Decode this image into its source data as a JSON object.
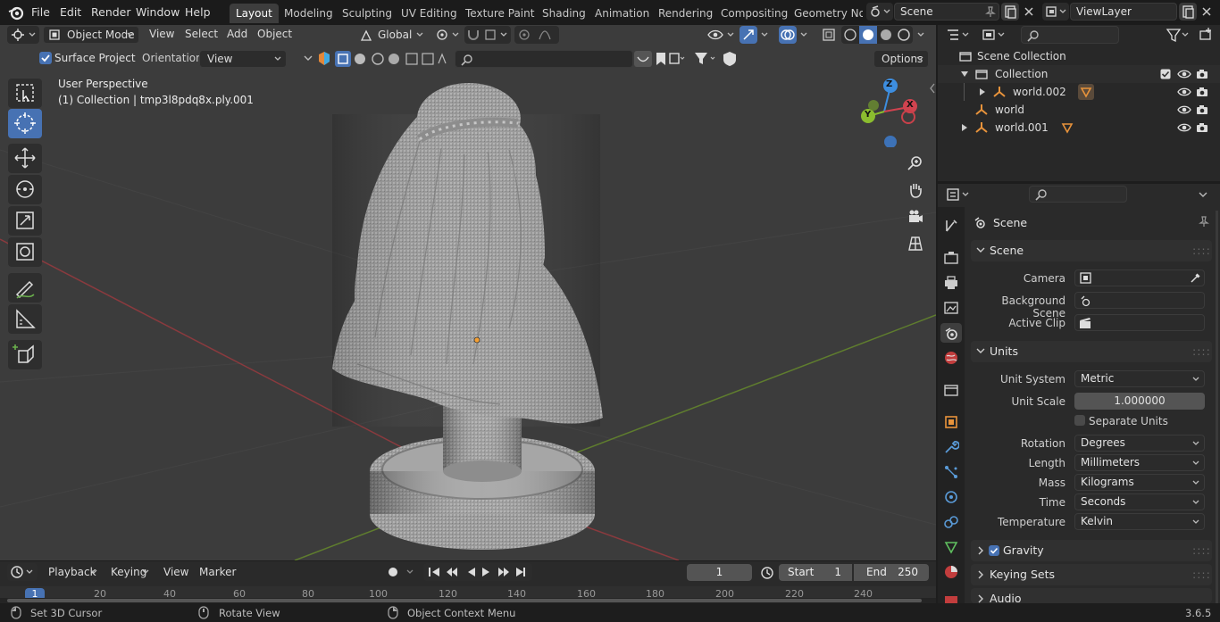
{
  "menus": [
    "File",
    "Edit",
    "Render",
    "Window",
    "Help"
  ],
  "workspaces": [
    "Layout",
    "Modeling",
    "Sculpting",
    "UV Editing",
    "Texture Paint",
    "Shading",
    "Animation",
    "Rendering",
    "Compositing",
    "Geometry Noc"
  ],
  "scene_field": "Scene",
  "viewlayer_field": "ViewLayer",
  "viewport_header": {
    "mode": "Object Mode",
    "menus": [
      "View",
      "Select",
      "Add",
      "Object"
    ],
    "transform_orientation": "Global",
    "surface_project": "Surface Project",
    "orientation_label": "Orientation:",
    "orientation_value": "View",
    "options": "Options"
  },
  "viewport_overlay": {
    "perspective": "User Perspective",
    "collection_info": "(1) Collection | tmp3l8pdq8x.ply.001"
  },
  "gizmo": {
    "x": "X",
    "y": "Y",
    "z": "Z"
  },
  "outliner": {
    "rows": [
      {
        "label": "Scene Collection"
      },
      {
        "label": "Collection"
      },
      {
        "label": "world.002"
      },
      {
        "label": "world"
      },
      {
        "label": "world.001"
      }
    ]
  },
  "properties": {
    "context": "Scene",
    "scene_panel": {
      "title": "Scene",
      "camera_label": "Camera",
      "background_label": "Background Scene",
      "clip_label": "Active Clip"
    },
    "units_panel": {
      "title": "Units",
      "unit_system_label": "Unit System",
      "unit_system": "Metric",
      "unit_scale_label": "Unit Scale",
      "unit_scale": "1.000000",
      "separate_units": "Separate Units",
      "rotation_label": "Rotation",
      "rotation": "Degrees",
      "length_label": "Length",
      "length": "Millimeters",
      "mass_label": "Mass",
      "mass": "Kilograms",
      "time_label": "Time",
      "time": "Seconds",
      "temperature_label": "Temperature",
      "temperature": "Kelvin"
    },
    "gravity": "Gravity",
    "keying_sets": "Keying Sets",
    "audio": "Audio"
  },
  "timeline": {
    "playback": "Playback",
    "keying": "Keying",
    "view": "View",
    "marker": "Marker",
    "current_frame": "1",
    "start_label": "Start",
    "start": "1",
    "end_label": "End",
    "end": "250",
    "ruler": [
      "1",
      "20",
      "40",
      "60",
      "80",
      "100",
      "120",
      "140",
      "160",
      "180",
      "200",
      "220",
      "240"
    ]
  },
  "status": {
    "left": "Set 3D Cursor",
    "middle": "Rotate View",
    "right": "Object Context Menu",
    "version": "3.6.5"
  },
  "colors": {
    "accent": "#4772b3",
    "active_ws": "#3d3d3d",
    "viewport": "#3c3c3c",
    "x_axis": "#d0434f",
    "y_axis": "#8bbd2f",
    "z_axis": "#3d8ee0"
  }
}
